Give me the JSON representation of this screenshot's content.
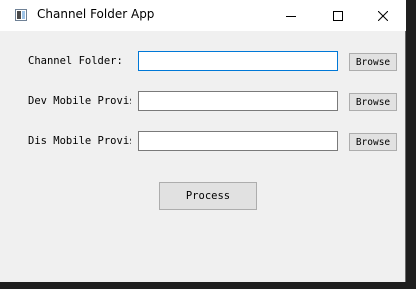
{
  "window": {
    "title": "Channel Folder App",
    "controls": {
      "minimize": "minimize-icon",
      "maximize": "maximize-icon",
      "close": "close-icon"
    }
  },
  "form": {
    "rows": [
      {
        "label": "Channel Folder:",
        "value": "",
        "button": "Browse"
      },
      {
        "label": "Dev Mobile Provis",
        "value": "",
        "button": "Browse"
      },
      {
        "label": "Dis Mobile Provis",
        "value": "",
        "button": "Browse"
      }
    ],
    "process_label": "Process"
  },
  "colors": {
    "window_bg": "#f0f0f0",
    "titlebar_bg": "#ffffff",
    "focus_border": "#0078d7",
    "button_bg": "#e1e1e1",
    "desktop_bg": "#1f1f1f"
  }
}
